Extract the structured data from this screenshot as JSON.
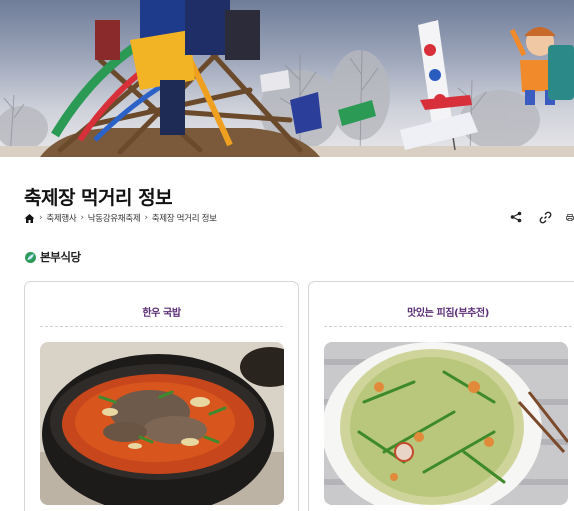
{
  "page": {
    "title": "축제장 먹거리 정보",
    "breadcrumb": [
      "축제행사",
      "낙동강유채축제",
      "축제장 먹거리 정보"
    ]
  },
  "toolbar": {
    "share_icon": "share-icon",
    "link_icon": "link-icon",
    "print_icon": "print-icon"
  },
  "section": {
    "title": "본부식당"
  },
  "cards": [
    {
      "title": "한우 국밥",
      "image": "beef-soup-photo"
    },
    {
      "title": "맛있는 피짐(부추전)",
      "image": "chive-pancake-photo"
    }
  ],
  "colors": {
    "card_title": "#5b2e77",
    "section_leaf": "#2e9a5a"
  }
}
